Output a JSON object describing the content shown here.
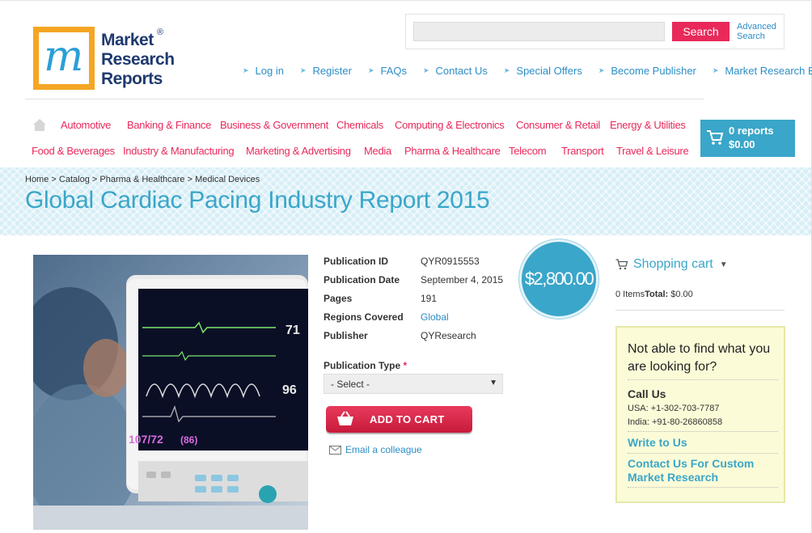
{
  "logo": {
    "line1": "Market",
    "line2": "Research",
    "line3": "Reports",
    "reg": "®",
    "letter_m": "m"
  },
  "search": {
    "placeholder": "",
    "button": "Search",
    "advanced": "Advanced Search"
  },
  "top_links": [
    "Log in",
    "Register",
    "FAQs",
    "Contact Us",
    "Special Offers",
    "Become Publisher",
    "Market Research Blog"
  ],
  "categories_row1": [
    "Automotive",
    "Banking & Finance",
    "Business & Government",
    "Chemicals",
    "Computing & Electronics",
    "Consumer & Retail",
    "Energy & Utilities"
  ],
  "categories_row2": [
    "Food & Beverages",
    "Industry & Manufacturing",
    "Marketing & Advertising",
    "Media",
    "Pharma & Healthcare",
    "Telecom",
    "Transport",
    "Travel & Leisure"
  ],
  "mini_cart": {
    "count": "0 reports",
    "total": "$0.00"
  },
  "breadcrumb": [
    "Home",
    "Catalog",
    "Pharma & Healthcare",
    "Medical Devices"
  ],
  "breadcrumb_sep": ">",
  "page_title": "Global Cardiac Pacing Industry Report 2015",
  "product": {
    "labels": {
      "pub_id": "Publication ID",
      "pub_date": "Publication Date",
      "pages": "Pages",
      "regions": "Regions Covered",
      "publisher": "Publisher"
    },
    "values": {
      "pub_id": "QYR0915553",
      "pub_date": "September 4, 2015",
      "pages": "191",
      "regions": "Global",
      "publisher": "QYResearch"
    },
    "price": "$2,800.00",
    "pub_type_label": "Publication Type",
    "required_mark": "*",
    "pub_type_selected": "- Select -",
    "add_to_cart": "ADD TO CART",
    "email_colleague": "Email a colleague",
    "monitor_readouts": {
      "hr": "71",
      "spo2": "96",
      "bp": "107/72",
      "map": "(86)"
    }
  },
  "sidebar": {
    "cart_title": "Shopping cart",
    "items_text": "0 Items",
    "total_label": "Total:",
    "total_value": "$0.00",
    "help_question": "Not able to find what you are looking for?",
    "call_us": "Call Us",
    "phone_usa": "USA: +1-302-703-7787",
    "phone_india": "India: +91-80-26860858",
    "write_to_us": "Write to Us",
    "custom_research": "Contact Us For Custom Market Research"
  },
  "colors": {
    "accent_pink": "#e8295a",
    "accent_blue": "#3aa6c9",
    "logo_orange": "#f5a623",
    "logo_navy": "#1e3a6e"
  }
}
